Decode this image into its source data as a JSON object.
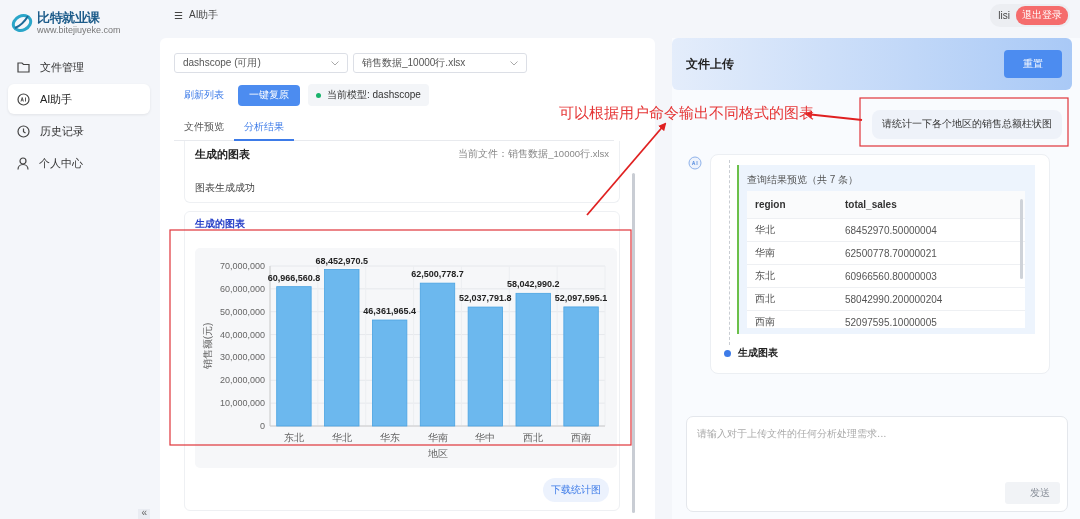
{
  "logo": {
    "name": "比特就业课",
    "url": "www.bitejiuyeke.com"
  },
  "header": {
    "menu_icon": "☰",
    "title": "AI助手",
    "user": "lisi",
    "logout_button": "退出登录"
  },
  "sidebar": {
    "items": [
      {
        "label": "文件管理",
        "selected": false
      },
      {
        "label": "AI助手",
        "selected": true
      },
      {
        "label": "历史记录",
        "selected": false
      },
      {
        "label": "个人中心",
        "selected": false
      }
    ],
    "collapse_button": "«"
  },
  "left_panel": {
    "model_select": "dashscope (可用)",
    "file_select": "销售数据_10000行.xlsx",
    "refresh_link": "刷新列表",
    "restore_button": "一键复原",
    "model_status": "当前模型: dashscope",
    "tabs": [
      {
        "label": "文件预览",
        "selected": false
      },
      {
        "label": "分析结果",
        "selected": true
      }
    ],
    "result_card": {
      "title": "生成的图表",
      "current_file": "当前文件：销售数据_10000行.xlsx",
      "message": "图表生成成功"
    },
    "chart_card": {
      "title": "生成的图表",
      "download_button": "下载统计图",
      "chart_data": {
        "type": "bar",
        "xlabel": "地区",
        "ylabel": "销售额(元)",
        "categories": [
          "东北",
          "华北",
          "华东",
          "华南",
          "华中",
          "西北",
          "西南"
        ],
        "values": [
          60966560.8,
          68452970.5,
          46361965.4,
          62500778.7,
          52037791.8,
          58042990.2,
          52097595.1
        ],
        "ylim": [
          0,
          70000000
        ],
        "yticks": [
          {
            "value": 0,
            "label": "0"
          },
          {
            "value": 10000000,
            "label": "10,000,000"
          },
          {
            "value": 20000000,
            "label": "20,000,000"
          },
          {
            "value": 30000000,
            "label": "30,000,000"
          },
          {
            "value": 40000000,
            "label": "40,000,000"
          },
          {
            "value": 50000000,
            "label": "50,000,000"
          },
          {
            "value": 60000000,
            "label": "60,000,000"
          },
          {
            "value": 70000000,
            "label": "70,000,000"
          }
        ],
        "value_labels": [
          "60,966,560.8",
          "68,452,970.5",
          "46,361,965.4",
          "62,500,778.7",
          "52,037,791.8",
          "58,042,990.2",
          "52,097,595.1"
        ],
        "grid": true
      }
    }
  },
  "right_panel": {
    "title": "文件上传",
    "reset_button": "重置",
    "user_message": "请统计一下各个地区的销售总额柱状图",
    "query_preview": {
      "title": "查询结果预览（共 7 条）",
      "columns": [
        "region",
        "total_sales"
      ],
      "rows": [
        [
          "华北",
          "68452970.50000004"
        ],
        [
          "华南",
          "62500778.70000021"
        ],
        [
          "东北",
          "60966560.80000003"
        ],
        [
          "西北",
          "58042990.200000204"
        ],
        [
          "西南",
          "52097595.10000005"
        ]
      ]
    },
    "step": "生成图表",
    "input": {
      "placeholder": "请输入对于上传文件的任何分析处理需求..."
    },
    "send_button": {
      "label": "发送",
      "disabled": true
    }
  },
  "annotation": {
    "text": "可以根据用户命令输出不同格式的图表"
  }
}
